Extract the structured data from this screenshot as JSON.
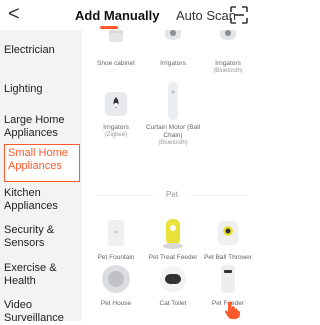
{
  "header": {
    "back_label": "<",
    "tab_manual": "Add Manually",
    "tab_auto": "Auto Scan"
  },
  "sidebar": {
    "items": [
      {
        "label": "Electrician"
      },
      {
        "label": "Lighting"
      },
      {
        "label": "Large Home Appliances"
      },
      {
        "label": "Small Home Appliances"
      },
      {
        "label": "Kitchen Appliances"
      },
      {
        "label": "Security & Sensors"
      },
      {
        "label": "Exercise & Health"
      },
      {
        "label": "Video Surveillance"
      }
    ],
    "active_index": 3
  },
  "content": {
    "top_row": [
      {
        "name": "Shoe cabinet",
        "sub": ""
      },
      {
        "name": "Irrigators",
        "sub": ""
      },
      {
        "name": "Irrigators",
        "sub": "(Bluetooth)"
      }
    ],
    "second_row": [
      {
        "name": "Irrigators",
        "sub": "(Zigbee)"
      },
      {
        "name": "Curtain Motor (Ball Chain)",
        "sub": "(Bluetooth)"
      }
    ],
    "section_label": "Pet",
    "pet_row1": [
      {
        "name": "Pet Fountain"
      },
      {
        "name": "Pet Treat Feeder"
      },
      {
        "name": "Pet Ball Thrower"
      }
    ],
    "pet_row2": [
      {
        "name": "Pet House"
      },
      {
        "name": "Cat Toilet"
      },
      {
        "name": "Pet Feeder"
      }
    ]
  },
  "colors": {
    "accent": "#ff5a2c",
    "sidebar_bg": "#f3f3f5",
    "treat_feeder_yellow": "#e8e23a"
  }
}
